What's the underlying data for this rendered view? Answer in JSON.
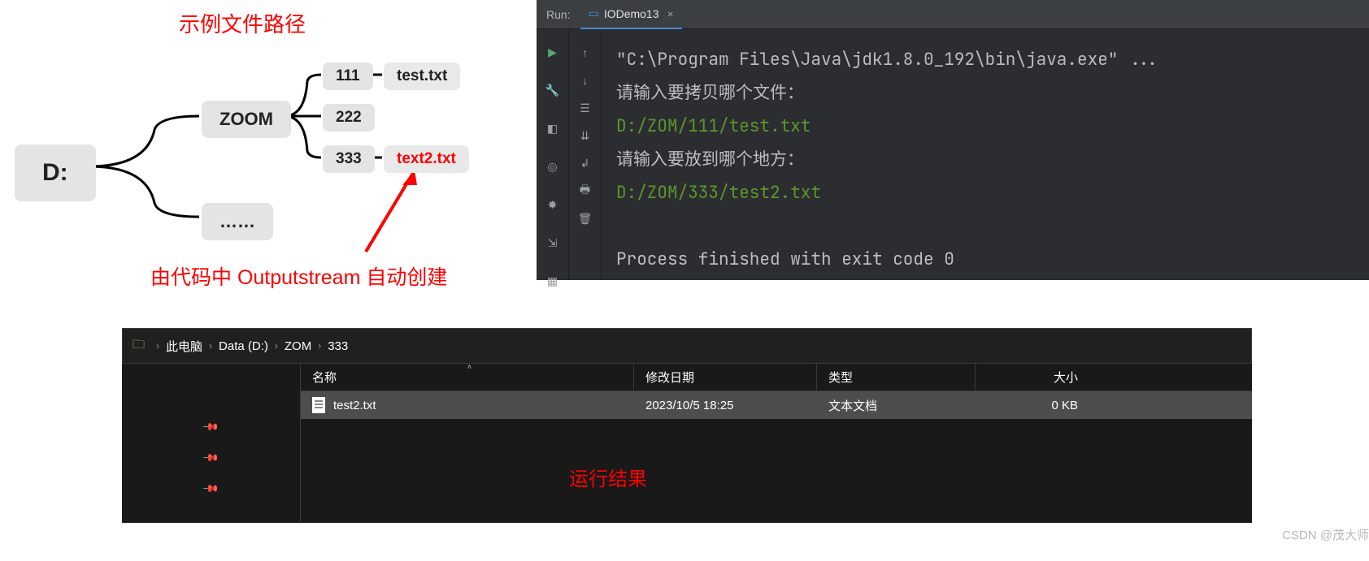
{
  "mindmap": {
    "title": "示例文件路径",
    "root": "D:",
    "zoom": "ZOOM",
    "dots": "……",
    "n111": "111",
    "n222": "222",
    "n333": "333",
    "file1": "test.txt",
    "file2": "text2.txt",
    "caption": "由代码中 Outputstream 自动创建"
  },
  "ide": {
    "run_label": "Run:",
    "tab": "IODemo13",
    "cmd": "\"C:\\Program Files\\Java\\jdk1.8.0_192\\bin\\java.exe\" ...",
    "prompt1": "请输入要拷贝哪个文件：",
    "input1": "D:/ZOM/111/test.txt",
    "prompt2": "请输入要放到哪个地方：",
    "input2": "D:/ZOM/333/test2.txt",
    "finish": "Process finished with exit code 0"
  },
  "explorer": {
    "crumbs": {
      "c1": "此电脑",
      "c2": "Data (D:)",
      "c3": "ZOM",
      "c4": "333"
    },
    "headers": {
      "name": "名称",
      "date": "修改日期",
      "type": "类型",
      "size": "大小"
    },
    "row": {
      "name": "test2.txt",
      "date": "2023/10/5 18:25",
      "type": "文本文档",
      "size": "0 KB"
    }
  },
  "labels": {
    "result": "运行结果",
    "watermark": "CSDN @茂大师"
  }
}
